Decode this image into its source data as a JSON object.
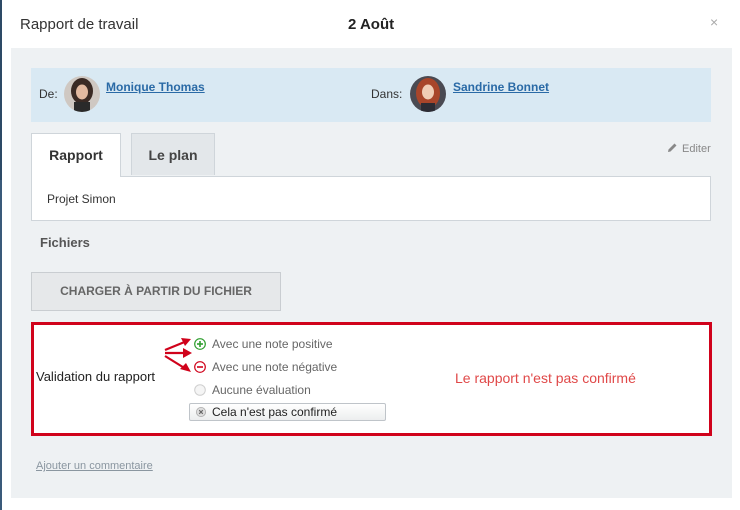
{
  "header": {
    "title": "Rapport de travail",
    "date": "2 Août",
    "close_symbol": "×"
  },
  "people": {
    "from_label": "De:",
    "from_name": "Monique Thomas",
    "to_label": "Dans:",
    "to_name": "Sandrine Bonnet"
  },
  "tabs": [
    {
      "label": "Rapport",
      "active": true
    },
    {
      "label": "Le plan",
      "active": false
    }
  ],
  "edit_label": "Editer",
  "report_content": "Projet Simon",
  "files": {
    "title": "Fichiers",
    "upload_label": "CHARGER À PARTIR DU FICHIER"
  },
  "validation": {
    "label": "Validation du rapport",
    "options": [
      {
        "label": "Avec une note positive",
        "icon": "plus-circle-icon"
      },
      {
        "label": "Avec une note négative",
        "icon": "minus-circle-icon"
      },
      {
        "label": "Aucune évaluation",
        "icon": "empty-circle-icon"
      }
    ],
    "button_label": "Cela n'est pas confirmé",
    "status_text": "Le rapport n'est pas confirmé"
  },
  "add_comment_label": "Ajouter un commentaire",
  "colors": {
    "accent_red": "#d0021b",
    "status_text": "#e04848",
    "link_blue": "#2a6aa6",
    "people_bg": "#d9e9f3",
    "positive_green": "#2e9e2e",
    "negative_red": "#d0021b"
  }
}
